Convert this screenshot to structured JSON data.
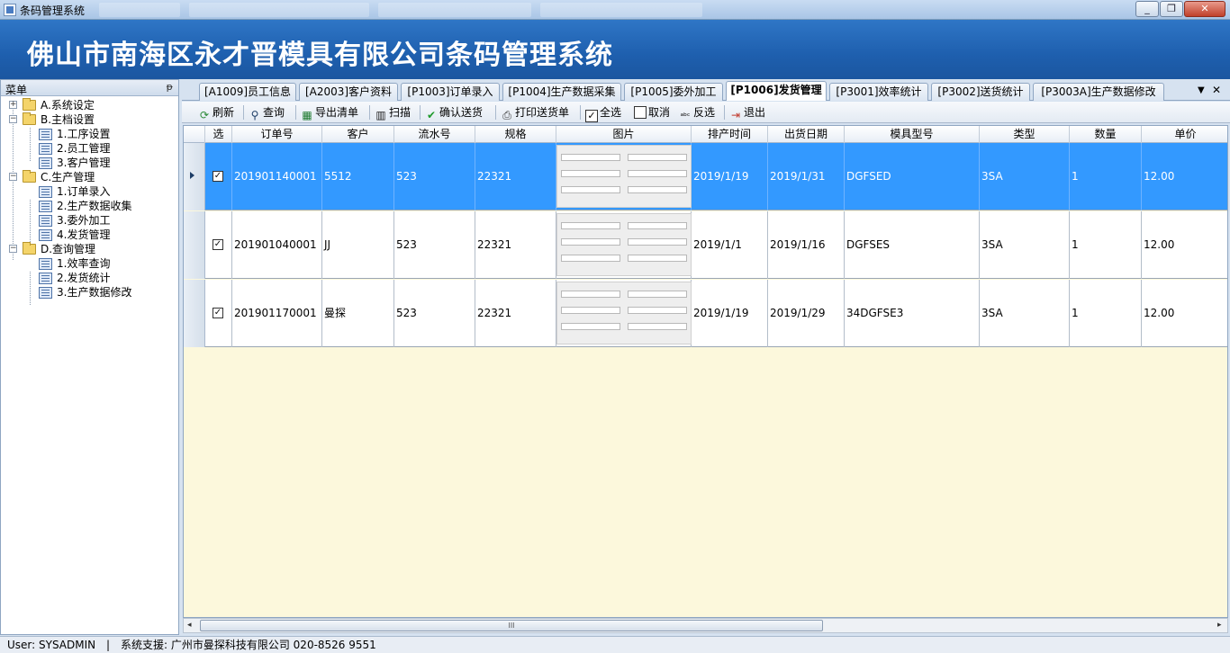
{
  "window": {
    "title": "条码管理系统",
    "minimize": "_",
    "maximize": "❐",
    "close": "✕"
  },
  "banner": {
    "text": "佛山市南海区永才晋模具有限公司条码管理系统"
  },
  "menu_panel": {
    "title": "菜单",
    "pin": "ᵽ",
    "groups": [
      {
        "label": "A.系统设定",
        "expander": "+",
        "items": []
      },
      {
        "label": "B.主档设置",
        "expander": "−",
        "items": [
          "1.工序设置",
          "2.员工管理",
          "3.客户管理"
        ]
      },
      {
        "label": "C.生产管理",
        "expander": "−",
        "items": [
          "1.订单录入",
          "2.生产数据收集",
          "3.委外加工",
          "4.发货管理"
        ]
      },
      {
        "label": "D.查询管理",
        "expander": "−",
        "items": [
          "1.效率查询",
          "2.发货统计",
          "3.生产数据修改"
        ]
      }
    ]
  },
  "tabs": [
    {
      "label": "[A1009]员工信息"
    },
    {
      "label": "[A2003]客户资料"
    },
    {
      "label": "[P1003]订单录入"
    },
    {
      "label": "[P1004]生产数据采集"
    },
    {
      "label": "[P1005]委外加工"
    },
    {
      "label": "[P1006]发货管理",
      "active": true
    },
    {
      "label": "[P3001]效率统计"
    },
    {
      "label": "[P3002]送货统计"
    },
    {
      "label": "[P3003A]生产数据修改"
    }
  ],
  "tab_controls": {
    "dropdown": "▼",
    "close": "✕"
  },
  "toolbar": {
    "refresh": "刷新",
    "query": "查询",
    "export": "导出清单",
    "scan": "扫描",
    "confirm": "确认送货",
    "print": "打印送货单",
    "select_all": "全选",
    "cancel": "取消",
    "invert": "反选",
    "exit": "退出"
  },
  "grid": {
    "columns": [
      "选",
      "订单号",
      "客户",
      "流水号",
      "规格",
      "图片",
      "排产时间",
      "出货日期",
      "模具型号",
      "类型",
      "数量",
      "单价"
    ],
    "rows": [
      {
        "checked": "✓",
        "order": "201901140001",
        "customer": "5512",
        "serial": "523",
        "spec": "22321",
        "schedule": "2019/1/19",
        "ship": "2019/1/31",
        "model": "DGFSED",
        "type": "3SA",
        "qty": "1",
        "price": "12.00"
      },
      {
        "checked": "✓",
        "order": "201901040001",
        "customer": "JJ",
        "serial": "523",
        "spec": "22321",
        "schedule": "2019/1/1",
        "ship": "2019/1/16",
        "model": "DGFSES",
        "type": "3SA",
        "qty": "1",
        "price": "12.00"
      },
      {
        "checked": "✓",
        "order": "201901170001",
        "customer": "曼探",
        "serial": "523",
        "spec": "22321",
        "schedule": "2019/1/19",
        "ship": "2019/1/29",
        "model": "34DGFSE3",
        "type": "3SA",
        "qty": "1",
        "price": "12.00"
      }
    ]
  },
  "scrollbar": {
    "left": "◂",
    "right": "▸",
    "grip": "III"
  },
  "status": {
    "user": "User: SYSADMIN",
    "divider": "|",
    "support": "系统支援: 广州市曼探科技有限公司 020-8526 9551"
  }
}
